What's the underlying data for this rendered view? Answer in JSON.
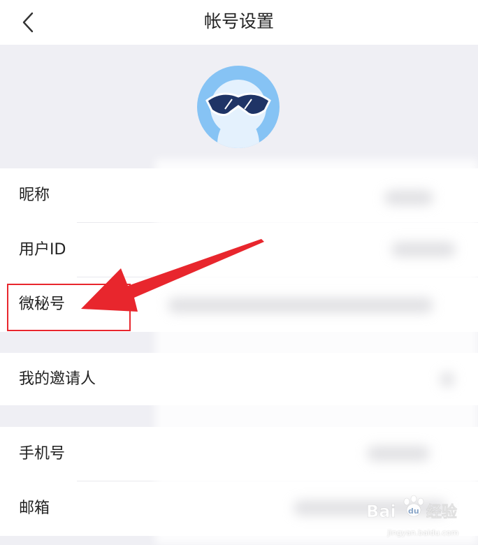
{
  "header": {
    "title": "帐号设置",
    "back_icon": "chevron-left-icon"
  },
  "avatar": {
    "icon": "avatar-sunglasses-icon",
    "colors": {
      "outer": "#86c3f4",
      "inner": "#e4f1fd",
      "glasses": "#1f3466"
    }
  },
  "groups": [
    {
      "items": [
        {
          "label": "昵称"
        },
        {
          "label": "用户ID"
        },
        {
          "label": "微秘号"
        }
      ]
    },
    {
      "items": [
        {
          "label": "我的邀请人"
        }
      ]
    },
    {
      "items": [
        {
          "label": "手机号"
        },
        {
          "label": "邮箱"
        }
      ]
    }
  ],
  "annotation": {
    "color": "#e8262d",
    "highlighted_item": "微秘号"
  },
  "watermark": {
    "logo_text": "Bai du 经验",
    "url": "jingyan.baidu.com"
  }
}
